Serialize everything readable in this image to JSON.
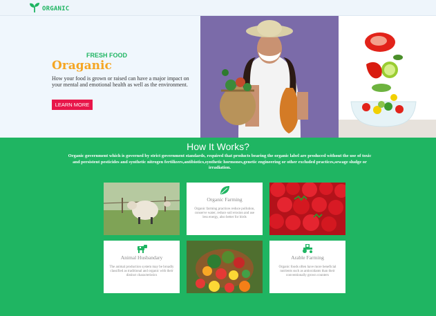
{
  "navbar": {
    "brand": "ORGANIC",
    "logo_icon": "sprout-icon"
  },
  "hero": {
    "tag": "FRESH FOOD",
    "title": "Oraganic",
    "description": "How your food is grown or raised can have a major impact on your mental and emotional health as well as the environment.",
    "button_label": "LEARN MORE",
    "colors": {
      "tag": "#1fb562",
      "title": "#f5a623",
      "button": "#e8164a"
    }
  },
  "how": {
    "title": "How It Works?",
    "description": "Organic government which is governed by strict government standards, required that products bearing the organic label are produced without the use of toxic and persistent pesticides and synthetic nitrogen fertilizers,antibiotics,synthetic hormones,genetic engineering or other excluded practices,sewage sludge or irradiation.",
    "cards": [
      {
        "title": "Organic Farming",
        "text": "Organic farming practices reduce pollution, conserve water, reduce soil erosion and use less energy, also better for birds",
        "icon": "leaf-icon"
      },
      {
        "title": "Animal Husbandary",
        "text": "The animal production system may be broadly classified as traditional and organic with their distinct characteristics",
        "icon": "cow-icon"
      },
      {
        "title": "Arable Farming",
        "text": "Organic foods often have more beneficial nutrients such as antioxidants than their conventionally grown counters",
        "icon": "tractor-icon"
      }
    ],
    "background": "#1fb562"
  }
}
